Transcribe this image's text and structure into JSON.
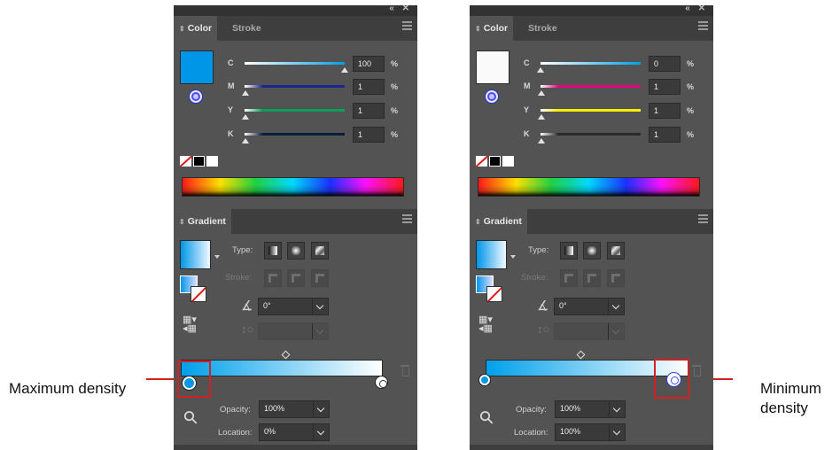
{
  "panels": [
    {
      "color_tab": "Color",
      "stroke_tab": "Stroke",
      "fill_swatch_color": "#0096e8",
      "channels": [
        {
          "label": "C",
          "value": "100",
          "unit": "%",
          "thumb_fraction": 1.0,
          "track_color": "#00a0e9"
        },
        {
          "label": "M",
          "value": "1",
          "unit": "%",
          "thumb_fraction": 0.01,
          "track_color": "#1c2690"
        },
        {
          "label": "Y",
          "value": "1",
          "unit": "%",
          "thumb_fraction": 0.01,
          "track_color": "#0a9e5a"
        },
        {
          "label": "K",
          "value": "1",
          "unit": "%",
          "thumb_fraction": 0.01,
          "track_color": "#0a1f3a"
        }
      ],
      "gradient_tab": "Gradient",
      "type_label": "Type:",
      "stroke_label": "Stroke:",
      "angle_value": "0°",
      "opacity_label": "Opacity:",
      "opacity_value": "100%",
      "location_label": "Location:",
      "location_value": "0%",
      "selected_stop": "left"
    },
    {
      "color_tab": "Color",
      "stroke_tab": "Stroke",
      "fill_swatch_color": "#fafafa",
      "channels": [
        {
          "label": "C",
          "value": "0",
          "unit": "%",
          "thumb_fraction": 0.0,
          "track_color": "#00a0e9"
        },
        {
          "label": "M",
          "value": "1",
          "unit": "%",
          "thumb_fraction": 0.01,
          "track_color": "#e4007f"
        },
        {
          "label": "Y",
          "value": "1",
          "unit": "%",
          "thumb_fraction": 0.01,
          "track_color": "#fff100"
        },
        {
          "label": "K",
          "value": "1",
          "unit": "%",
          "thumb_fraction": 0.01,
          "track_color": "#2a2a2a"
        }
      ],
      "gradient_tab": "Gradient",
      "type_label": "Type:",
      "stroke_label": "Stroke:",
      "angle_value": "0°",
      "opacity_label": "Opacity:",
      "opacity_value": "100%",
      "location_label": "Location:",
      "location_value": "100%",
      "selected_stop": "right"
    }
  ],
  "annotations": {
    "left": "Maximum density",
    "right": "Minimum density"
  },
  "colors": {
    "panel_bg": "#535353",
    "tab_bar": "#3e3e3e",
    "highlight": "#d42020",
    "gradient_start": "#00a0ea",
    "gradient_end": "#ffffff"
  }
}
